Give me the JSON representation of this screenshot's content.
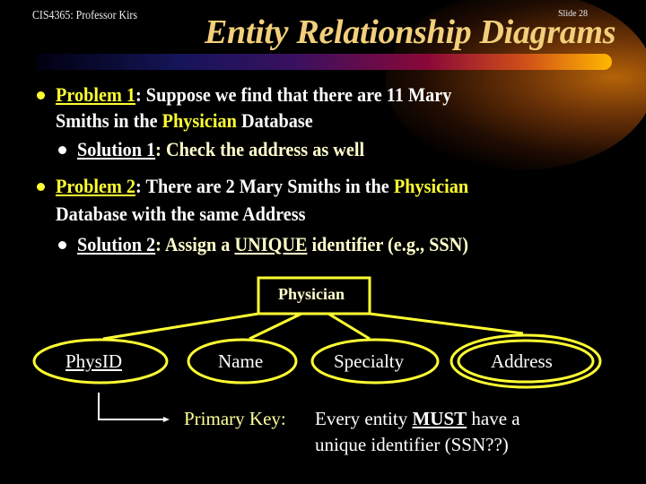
{
  "header": {
    "course": "CIS4365: Professor Kirs",
    "slide_number": "Slide 28",
    "title": "Entity Relationship Diagrams"
  },
  "bullets": {
    "p1_label": "Problem 1",
    "p1_text_a": ": Suppose we find that there are 11 Mary",
    "p1_text_b": "Smiths in the ",
    "p1_entity": "Physician",
    "p1_text_c": " Database",
    "s1_label": "Solution 1",
    "s1_text": ": Check the address as well",
    "p2_label": "Problem 2",
    "p2_text_a": ": There are 2 Mary Smiths in the ",
    "p2_entity": "Physician",
    "p2_text_b": "Database with the same Address",
    "s2_label": "Solution 2",
    "s2_text_a": ": Assign a ",
    "s2_unique": "UNIQUE",
    "s2_text_b": " identifier (e.g., SSN)"
  },
  "diagram": {
    "entity": "Physician",
    "attributes": [
      {
        "name": "PhysID",
        "key": true,
        "multivalued": false
      },
      {
        "name": "Name",
        "key": false,
        "multivalued": false
      },
      {
        "name": "Specialty",
        "key": false,
        "multivalued": false
      },
      {
        "name": "Address",
        "key": false,
        "multivalued": true
      }
    ],
    "note_label": "Primary Key:",
    "note_text_a": "Every entity ",
    "note_must": "MUST",
    "note_text_b": " have a",
    "note_text_c": "unique identifier (SSN??)"
  },
  "colors": {
    "accent_yellow": "#ffff33",
    "title_gold": "#f2cf7a",
    "background": "#000000"
  }
}
